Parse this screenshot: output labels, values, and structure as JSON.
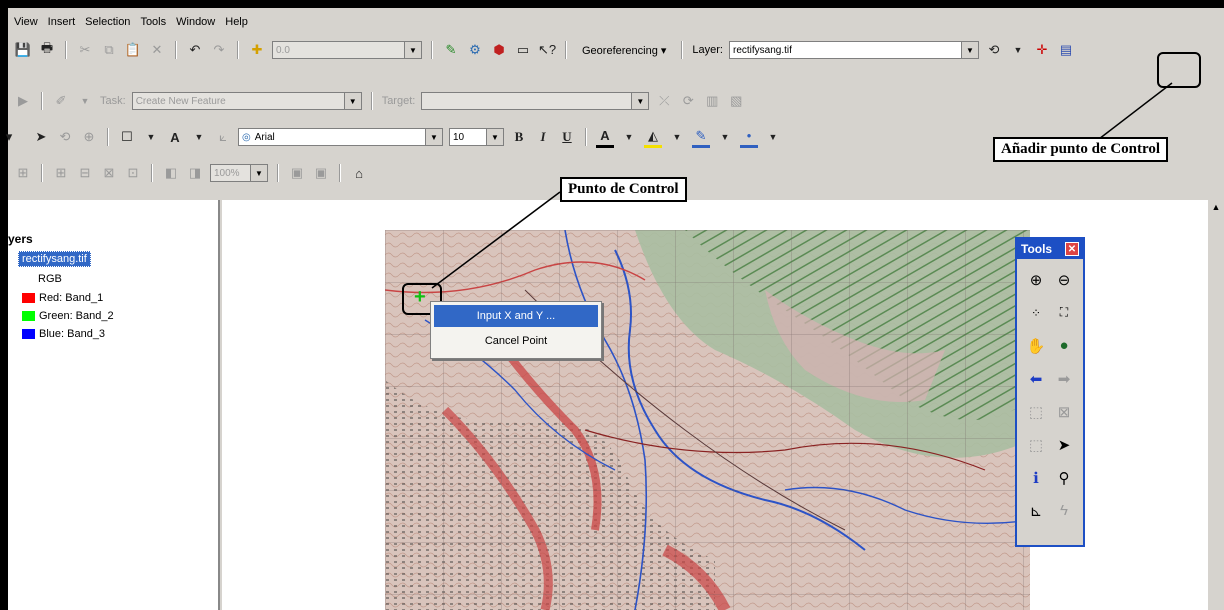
{
  "menubar": [
    "View",
    "Insert",
    "Selection",
    "Tools",
    "Window",
    "Help"
  ],
  "toolbar1": {
    "scale_value": "0.0",
    "georeferencing_label": "Georeferencing ▾",
    "layer_label": "Layer:",
    "layer_value": "rectifysang.tif"
  },
  "toolbar2": {
    "task_label": "Task:",
    "task_value": "Create New Feature",
    "target_label": "Target:"
  },
  "toolbar3": {
    "font_name": "Arial",
    "font_size": "10",
    "bold": "B",
    "italic": "I",
    "underline": "U",
    "text_tool": "A"
  },
  "toolbar4": {
    "zoom_value": "100%"
  },
  "toc": {
    "title": "yers",
    "layer_name": "rectifysang.tif",
    "rgb_label": "RGB",
    "bands": [
      {
        "label": "Red:   Band_1",
        "color": "#ff0000"
      },
      {
        "label": "Green: Band_2",
        "color": "#00ff00"
      },
      {
        "label": "Blue:  Band_3",
        "color": "#0000ff"
      }
    ]
  },
  "context_menu": [
    "Input X and Y ...",
    "Cancel Point"
  ],
  "tools_window": {
    "title": "Tools"
  },
  "callouts": {
    "control_point": "Punto de Control",
    "add_control_point": "Añadir punto de Control"
  }
}
